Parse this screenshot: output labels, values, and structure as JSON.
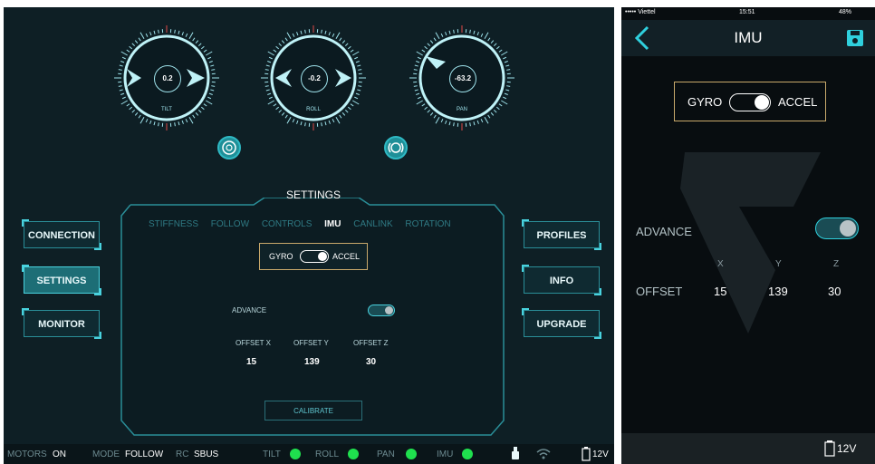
{
  "desktop": {
    "dials": [
      {
        "name": "tilt",
        "value": "0.2",
        "caption": "TILT"
      },
      {
        "name": "roll",
        "value": "-0.2",
        "caption": "ROLL"
      },
      {
        "name": "pan",
        "value": "-63.2",
        "caption": "PAN"
      }
    ],
    "left_buttons": [
      {
        "label": "CONNECTION",
        "active": false
      },
      {
        "label": "SETTINGS",
        "active": true
      },
      {
        "label": "MONITOR",
        "active": false
      }
    ],
    "right_buttons": [
      {
        "label": "PROFILES"
      },
      {
        "label": "INFO"
      },
      {
        "label": "UPGRADE"
      }
    ],
    "settings_title": "SETTINGS",
    "tabs": [
      "STIFFNESS",
      "FOLLOW",
      "CONTROLS",
      "IMU",
      "CANLINK",
      "ROTATION"
    ],
    "active_tab": "IMU",
    "gyro_label": "GYRO",
    "accel_label": "ACCEL",
    "advance_label": "ADVANCE",
    "offsets": [
      {
        "label": "OFFSET X",
        "value": "15"
      },
      {
        "label": "OFFSET Y",
        "value": "139"
      },
      {
        "label": "OFFSET Z",
        "value": "30"
      }
    ],
    "calibrate_label": "CALIBRATE",
    "status": {
      "motors_label": "MOTORS",
      "motors_value": "ON",
      "mode_label": "MODE",
      "mode_value": "FOLLOW",
      "rc_label": "RC",
      "rc_value": "SBUS",
      "tilt": "TILT",
      "roll": "ROLL",
      "pan": "PAN",
      "imu": "IMU",
      "voltage": "12V"
    }
  },
  "mobile": {
    "carrier": "••••• Viettel",
    "time": "15:51",
    "battery": "48%",
    "title": "IMU",
    "gyro_label": "GYRO",
    "accel_label": "ACCEL",
    "advance_label": "ADVANCE",
    "axes": [
      "X",
      "Y",
      "Z"
    ],
    "offset_label": "OFFSET",
    "offset_values": [
      "15",
      "139",
      "30"
    ],
    "voltage": "12V"
  },
  "colors": {
    "accent": "#49d2de",
    "status_ok": "#1fe04e",
    "highlight_border": "#c9a96b"
  }
}
